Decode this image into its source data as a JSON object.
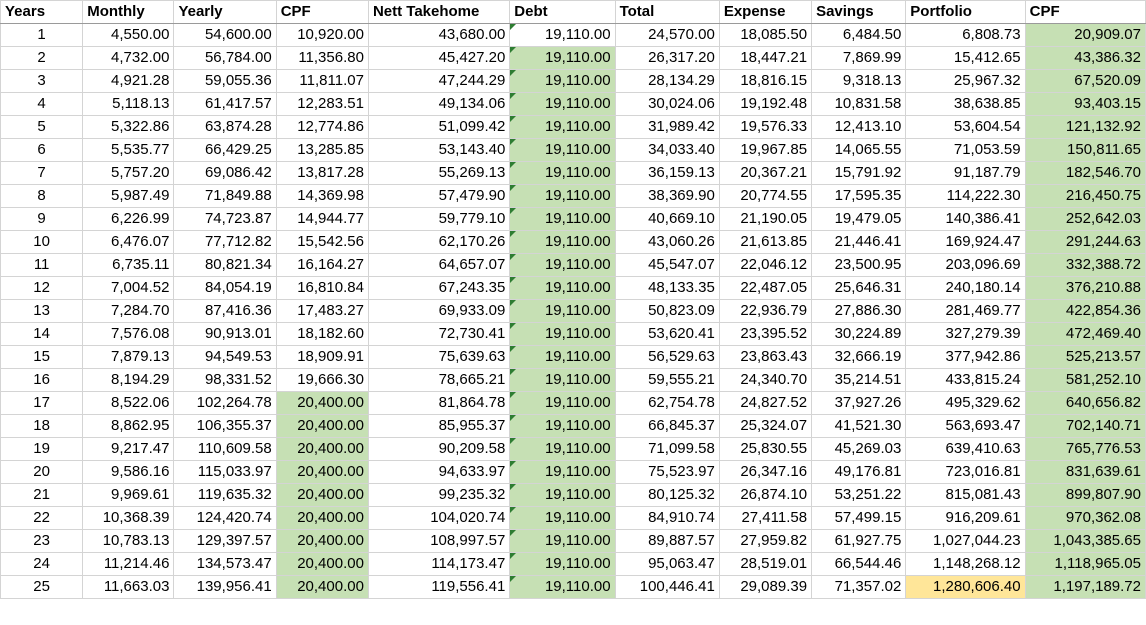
{
  "headers": [
    "Years",
    "Monthly",
    "Yearly",
    "CPF",
    "Nett Takehome",
    "Debt",
    "Total",
    "Expense",
    "Savings",
    "Portfolio",
    "CPF"
  ],
  "rows": [
    [
      "1",
      "4,550.00",
      "54,600.00",
      "10,920.00",
      "43,680.00",
      "19,110.00",
      "24,570.00",
      "18,085.50",
      "6,484.50",
      "6,808.73",
      "20,909.07"
    ],
    [
      "2",
      "4,732.00",
      "56,784.00",
      "11,356.80",
      "45,427.20",
      "19,110.00",
      "26,317.20",
      "18,447.21",
      "7,869.99",
      "15,412.65",
      "43,386.32"
    ],
    [
      "3",
      "4,921.28",
      "59,055.36",
      "11,811.07",
      "47,244.29",
      "19,110.00",
      "28,134.29",
      "18,816.15",
      "9,318.13",
      "25,967.32",
      "67,520.09"
    ],
    [
      "4",
      "5,118.13",
      "61,417.57",
      "12,283.51",
      "49,134.06",
      "19,110.00",
      "30,024.06",
      "19,192.48",
      "10,831.58",
      "38,638.85",
      "93,403.15"
    ],
    [
      "5",
      "5,322.86",
      "63,874.28",
      "12,774.86",
      "51,099.42",
      "19,110.00",
      "31,989.42",
      "19,576.33",
      "12,413.10",
      "53,604.54",
      "121,132.92"
    ],
    [
      "6",
      "5,535.77",
      "66,429.25",
      "13,285.85",
      "53,143.40",
      "19,110.00",
      "34,033.40",
      "19,967.85",
      "14,065.55",
      "71,053.59",
      "150,811.65"
    ],
    [
      "7",
      "5,757.20",
      "69,086.42",
      "13,817.28",
      "55,269.13",
      "19,110.00",
      "36,159.13",
      "20,367.21",
      "15,791.92",
      "91,187.79",
      "182,546.70"
    ],
    [
      "8",
      "5,987.49",
      "71,849.88",
      "14,369.98",
      "57,479.90",
      "19,110.00",
      "38,369.90",
      "20,774.55",
      "17,595.35",
      "114,222.30",
      "216,450.75"
    ],
    [
      "9",
      "6,226.99",
      "74,723.87",
      "14,944.77",
      "59,779.10",
      "19,110.00",
      "40,669.10",
      "21,190.05",
      "19,479.05",
      "140,386.41",
      "252,642.03"
    ],
    [
      "10",
      "6,476.07",
      "77,712.82",
      "15,542.56",
      "62,170.26",
      "19,110.00",
      "43,060.26",
      "21,613.85",
      "21,446.41",
      "169,924.47",
      "291,244.63"
    ],
    [
      "11",
      "6,735.11",
      "80,821.34",
      "16,164.27",
      "64,657.07",
      "19,110.00",
      "45,547.07",
      "22,046.12",
      "23,500.95",
      "203,096.69",
      "332,388.72"
    ],
    [
      "12",
      "7,004.52",
      "84,054.19",
      "16,810.84",
      "67,243.35",
      "19,110.00",
      "48,133.35",
      "22,487.05",
      "25,646.31",
      "240,180.14",
      "376,210.88"
    ],
    [
      "13",
      "7,284.70",
      "87,416.36",
      "17,483.27",
      "69,933.09",
      "19,110.00",
      "50,823.09",
      "22,936.79",
      "27,886.30",
      "281,469.77",
      "422,854.36"
    ],
    [
      "14",
      "7,576.08",
      "90,913.01",
      "18,182.60",
      "72,730.41",
      "19,110.00",
      "53,620.41",
      "23,395.52",
      "30,224.89",
      "327,279.39",
      "472,469.40"
    ],
    [
      "15",
      "7,879.13",
      "94,549.53",
      "18,909.91",
      "75,639.63",
      "19,110.00",
      "56,529.63",
      "23,863.43",
      "32,666.19",
      "377,942.86",
      "525,213.57"
    ],
    [
      "16",
      "8,194.29",
      "98,331.52",
      "19,666.30",
      "78,665.21",
      "19,110.00",
      "59,555.21",
      "24,340.70",
      "35,214.51",
      "433,815.24",
      "581,252.10"
    ],
    [
      "17",
      "8,522.06",
      "102,264.78",
      "20,400.00",
      "81,864.78",
      "19,110.00",
      "62,754.78",
      "24,827.52",
      "37,927.26",
      "495,329.62",
      "640,656.82"
    ],
    [
      "18",
      "8,862.95",
      "106,355.37",
      "20,400.00",
      "85,955.37",
      "19,110.00",
      "66,845.37",
      "25,324.07",
      "41,521.30",
      "563,693.47",
      "702,140.71"
    ],
    [
      "19",
      "9,217.47",
      "110,609.58",
      "20,400.00",
      "90,209.58",
      "19,110.00",
      "71,099.58",
      "25,830.55",
      "45,269.03",
      "639,410.63",
      "765,776.53"
    ],
    [
      "20",
      "9,586.16",
      "115,033.97",
      "20,400.00",
      "94,633.97",
      "19,110.00",
      "75,523.97",
      "26,347.16",
      "49,176.81",
      "723,016.81",
      "831,639.61"
    ],
    [
      "21",
      "9,969.61",
      "119,635.32",
      "20,400.00",
      "99,235.32",
      "19,110.00",
      "80,125.32",
      "26,874.10",
      "53,251.22",
      "815,081.43",
      "899,807.90"
    ],
    [
      "22",
      "10,368.39",
      "124,420.74",
      "20,400.00",
      "104,020.74",
      "19,110.00",
      "84,910.74",
      "27,411.58",
      "57,499.15",
      "916,209.61",
      "970,362.08"
    ],
    [
      "23",
      "10,783.13",
      "129,397.57",
      "20,400.00",
      "108,997.57",
      "19,110.00",
      "89,887.57",
      "27,959.82",
      "61,927.75",
      "1,027,044.23",
      "1,043,385.65"
    ],
    [
      "24",
      "11,214.46",
      "134,573.47",
      "20,400.00",
      "114,173.47",
      "19,110.00",
      "95,063.47",
      "28,519.01",
      "66,544.46",
      "1,148,268.12",
      "1,118,965.05"
    ],
    [
      "25",
      "11,663.03",
      "139,956.41",
      "20,400.00",
      "119,556.41",
      "19,110.00",
      "100,446.41",
      "29,089.39",
      "71,357.02",
      "1,280,606.40",
      "1,197,189.72"
    ]
  ],
  "colors": {
    "green": "#c6e0b4",
    "yellow": "#ffe699",
    "indicator": "#2e7d32"
  }
}
